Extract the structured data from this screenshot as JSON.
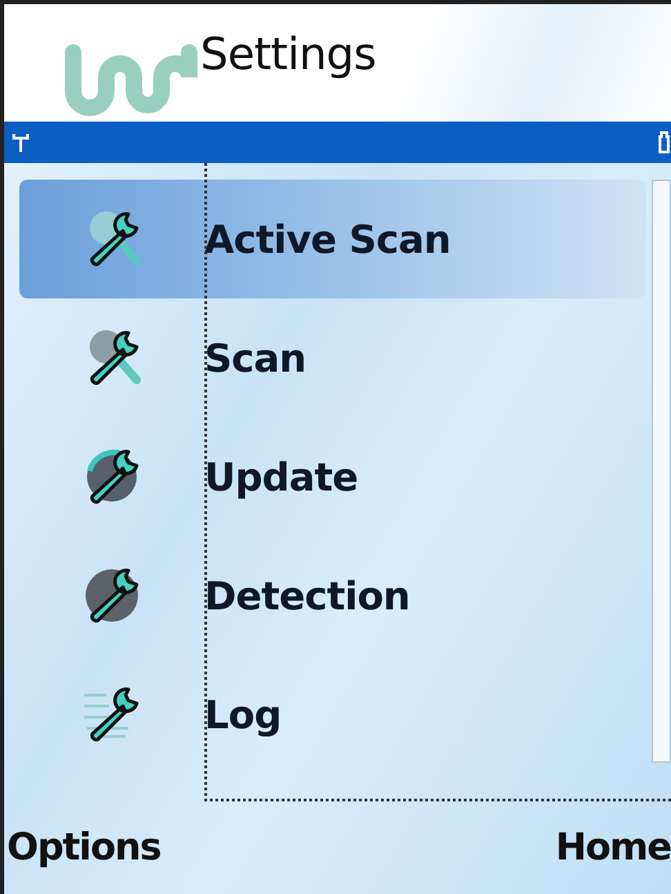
{
  "title": "Settings",
  "menu": [
    {
      "label": "Active Scan",
      "kind": "active-scan",
      "selected": true
    },
    {
      "label": "Scan",
      "kind": "scan",
      "selected": false
    },
    {
      "label": "Update",
      "kind": "update",
      "selected": false
    },
    {
      "label": "Detection",
      "kind": "detection",
      "selected": false
    },
    {
      "label": "Log",
      "kind": "log",
      "selected": false
    }
  ],
  "softkeys": {
    "left": "Options",
    "right": "Home"
  }
}
